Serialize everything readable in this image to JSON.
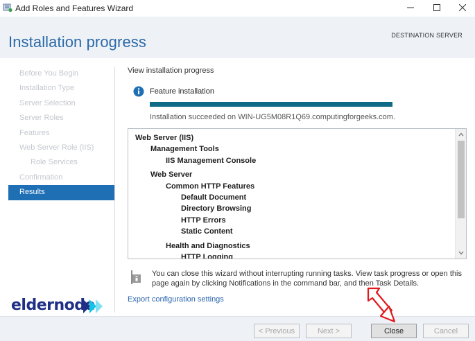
{
  "window": {
    "title": "Add Roles and Features Wizard",
    "controls": [
      "minimize",
      "maximize",
      "close"
    ]
  },
  "header": {
    "page_title": "Installation progress",
    "destination_label": "DESTINATION SERVER"
  },
  "nav": {
    "items": [
      {
        "label": "Before You Begin",
        "state": "disabled"
      },
      {
        "label": "Installation Type",
        "state": "disabled"
      },
      {
        "label": "Server Selection",
        "state": "disabled"
      },
      {
        "label": "Server Roles",
        "state": "disabled"
      },
      {
        "label": "Features",
        "state": "disabled"
      },
      {
        "label": "Web Server Role (IIS)",
        "state": "disabled"
      },
      {
        "label": "Role Services",
        "state": "disabled"
      },
      {
        "label": "Confirmation",
        "state": "disabled"
      },
      {
        "label": "Results",
        "state": "active"
      }
    ]
  },
  "main": {
    "section_label": "View installation progress",
    "feature_label": "Feature installation",
    "progress_fraction": 1.0,
    "result_text": "Installation succeeded on WIN-UG5M08R1Q69.computingforgeeks.com.",
    "tree": [
      {
        "label": "Web Server (IIS)",
        "level": 0
      },
      {
        "label": "Management Tools",
        "level": 1
      },
      {
        "label": "IIS Management Console",
        "level": 2
      },
      {
        "label": "Web Server",
        "level": 1
      },
      {
        "label": "Common HTTP Features",
        "level": 2
      },
      {
        "label": "Default Document",
        "level": 3
      },
      {
        "label": "Directory Browsing",
        "level": 3
      },
      {
        "label": "HTTP Errors",
        "level": 3
      },
      {
        "label": "Static Content",
        "level": 3
      },
      {
        "label": "Health and Diagnostics",
        "level": 2
      },
      {
        "label": "HTTP Logging",
        "level": 3
      }
    ],
    "note_text": "You can close this wizard without interrupting running tasks. View task progress or open this page again by clicking Notifications in the command bar, and then Task Details.",
    "export_link": "Export configuration settings"
  },
  "footer": {
    "previous_label": "< Previous",
    "next_label": "Next >",
    "close_label": "Close",
    "cancel_label": "Cancel"
  },
  "watermark": {
    "text": "eldernode"
  },
  "colors": {
    "title_blue": "#2b6aa7",
    "nav_active": "#1f6fb5",
    "progress": "#0f6a86",
    "link": "#2a64ad",
    "annotation_arrow": "#e0191e",
    "logo_navy": "#1f2f86",
    "logo_cyan": "#12c4e8"
  }
}
